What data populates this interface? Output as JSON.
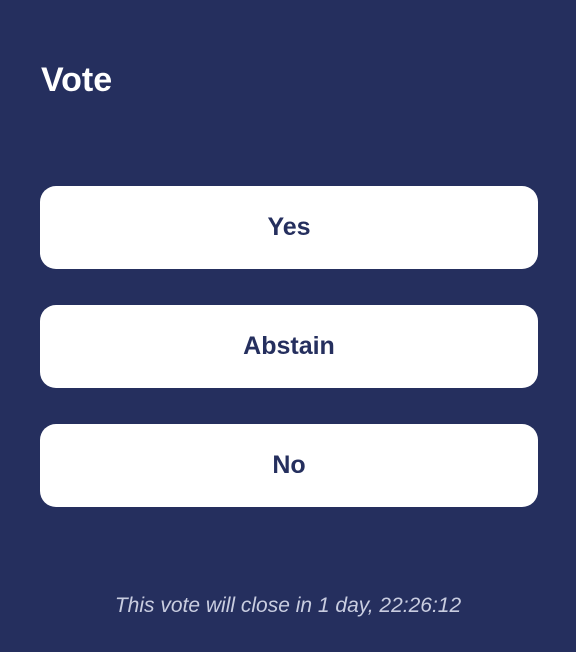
{
  "vote": {
    "title": "Vote",
    "options": [
      {
        "label": "Yes"
      },
      {
        "label": "Abstain"
      },
      {
        "label": "No"
      }
    ],
    "closing_text": "This vote will close in 1 day, 22:26:12"
  },
  "colors": {
    "background": "#252f5e",
    "button_background": "#ffffff",
    "button_text": "#252f5e",
    "footer_text": "#c9cde0"
  }
}
